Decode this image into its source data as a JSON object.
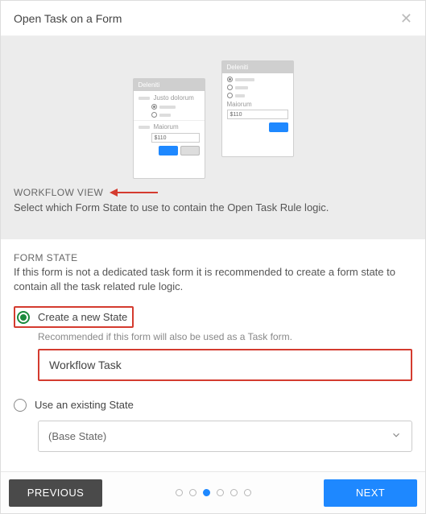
{
  "modal": {
    "title": "Open Task on a Form"
  },
  "illus": {
    "form_back_title": "Deleniti",
    "form_front_title": "Deleniti",
    "text_justo": "Justo dolorum",
    "text_maiorum": "Maiorum",
    "text_price": "$110"
  },
  "workflow_view": {
    "label": "WORKFLOW VIEW",
    "desc": "Select which Form State to use to contain the Open Task Rule logic."
  },
  "form_state": {
    "heading": "FORM STATE",
    "help": "If this form is not a dedicated task form it is recommended to create a form state to contain all the task related rule logic.",
    "opt_create": "Create a new State",
    "opt_create_sub": "Recommended if this form will also be used as a Task form.",
    "new_state_value": "Workflow Task",
    "opt_existing": "Use an existing State",
    "existing_selected": "(Base State)"
  },
  "wizard": {
    "prev": "Previous",
    "next": "Next",
    "step_count": 6,
    "active_step": 3
  }
}
